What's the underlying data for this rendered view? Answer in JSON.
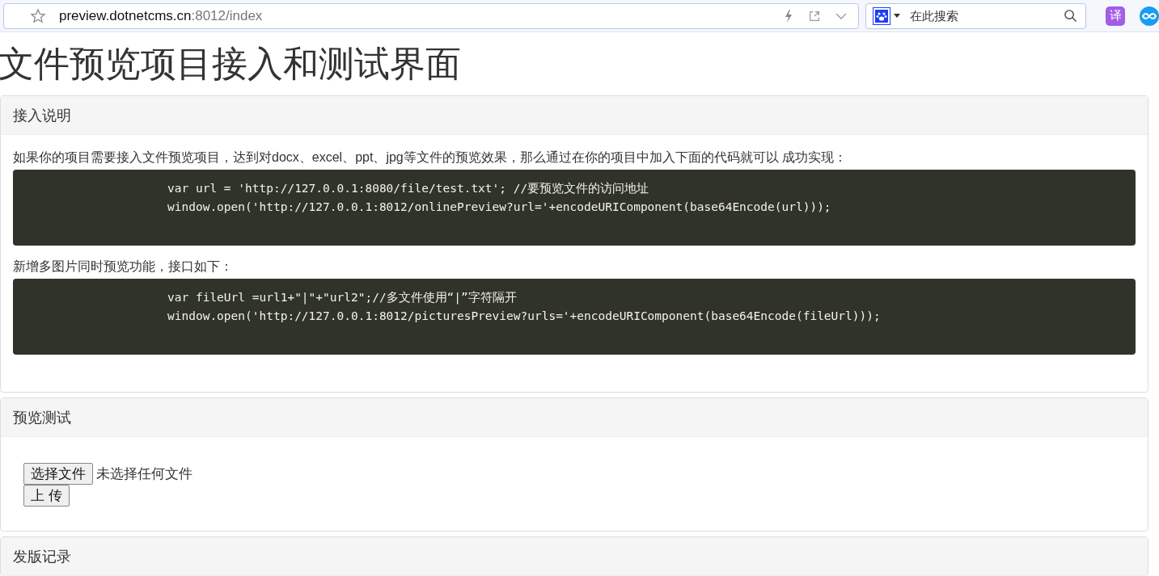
{
  "browser": {
    "address_host": "preview.dotnetcms.cn",
    "address_rest": ":8012/index",
    "search_placeholder": "在此搜索",
    "extension_label": "译"
  },
  "page": {
    "title": "文件预览项目接入和测试界面",
    "panels": [
      {
        "kind": "instructions",
        "heading": "接入说明",
        "sections": [
          {
            "text": "如果你的项目需要接入文件预览项目，达到对docx、excel、ppt、jpg等文件的预览效果，那么通过在你的项目中加入下面的代码就可以 成功实现：",
            "code": [
              "var url = 'http://127.0.0.1:8080/file/test.txt'; //要预览文件的访问地址",
              "window.open('http://127.0.0.1:8012/onlinePreview?url='+encodeURIComponent(base64Encode(url)));"
            ]
          },
          {
            "text": "新增多图片同时预览功能，接口如下：",
            "code": [
              "var fileUrl =url1+\"|\"+\"url2\";//多文件使用“|”字符隔开",
              "window.open('http://127.0.0.1:8012/picturesPreview?urls='+encodeURIComponent(base64Encode(fileUrl)));"
            ]
          }
        ]
      },
      {
        "kind": "upload",
        "heading": "预览测试",
        "file_button": "选择文件",
        "file_status": "未选择任何文件",
        "upload_button": "上 传"
      },
      {
        "kind": "heading_only",
        "heading": "发版记录"
      }
    ]
  }
}
